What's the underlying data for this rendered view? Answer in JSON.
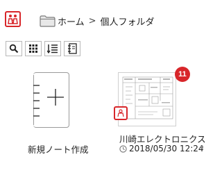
{
  "header": {
    "breadcrumb": [
      "ホーム",
      "個人フォルダ"
    ],
    "separator": ">"
  },
  "toolbar": {
    "buttons": [
      {
        "icon": "search-icon"
      },
      {
        "icon": "grid-view-icon"
      },
      {
        "icon": "sort-icon"
      },
      {
        "icon": "notebook-list-icon"
      }
    ]
  },
  "notes": [
    {
      "label": "新規ノート作成",
      "icon": "new-note-icon"
    },
    {
      "title": "川崎エレクトロニクス",
      "date": "2018/05/30 12:24",
      "badge": "11",
      "icons": [
        "document-thumbnail",
        "shared-mark-icon",
        "clock-icon"
      ]
    }
  ],
  "colors": {
    "accent": "#d8262a",
    "text": "#222222",
    "border": "#b8b8b8"
  }
}
